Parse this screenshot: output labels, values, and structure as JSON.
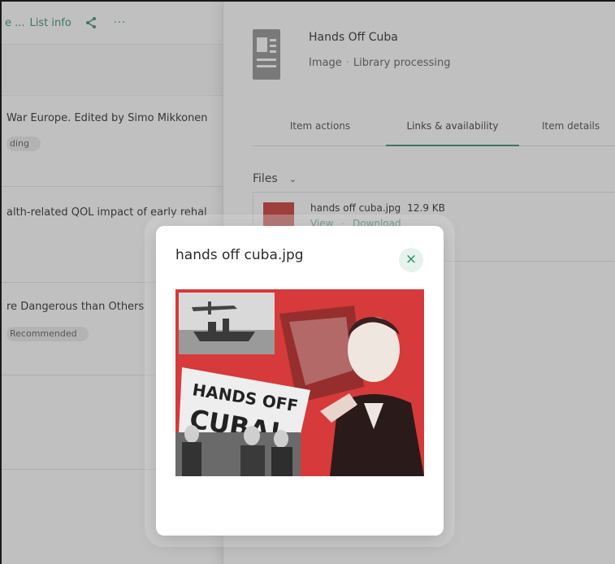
{
  "left_toolbar": {
    "crumb": "e ...",
    "list_info": "List info",
    "share_icon": "share-icon",
    "more": "···"
  },
  "list_items": [
    {
      "title": "War Europe. Edited by Simo Mikkonen",
      "badge": "ding"
    },
    {
      "title": "alth-related QOL impact of early rehal",
      "badge": ""
    },
    {
      "title": "re Dangerous than Others",
      "badge": "Recommended"
    }
  ],
  "detail": {
    "title": "Hands Off Cuba",
    "type": "Image",
    "status": "Library processing",
    "tabs": [
      "Item actions",
      "Links & availability",
      "Item details"
    ],
    "active_tab": "Links & availability",
    "files_label": "Files",
    "file": {
      "name": "hands off cuba.jpg",
      "size": "12.9 KB",
      "view": "View",
      "download": "Download"
    }
  },
  "modal": {
    "title": "hands off cuba.jpg",
    "close_icon": "close-icon",
    "image_banner": "HANDS OFF CUBA!"
  },
  "colors": {
    "accent": "#2e8a62",
    "overlay": "rgba(90,90,90,0.38)",
    "image_red": "#d63a3a"
  }
}
